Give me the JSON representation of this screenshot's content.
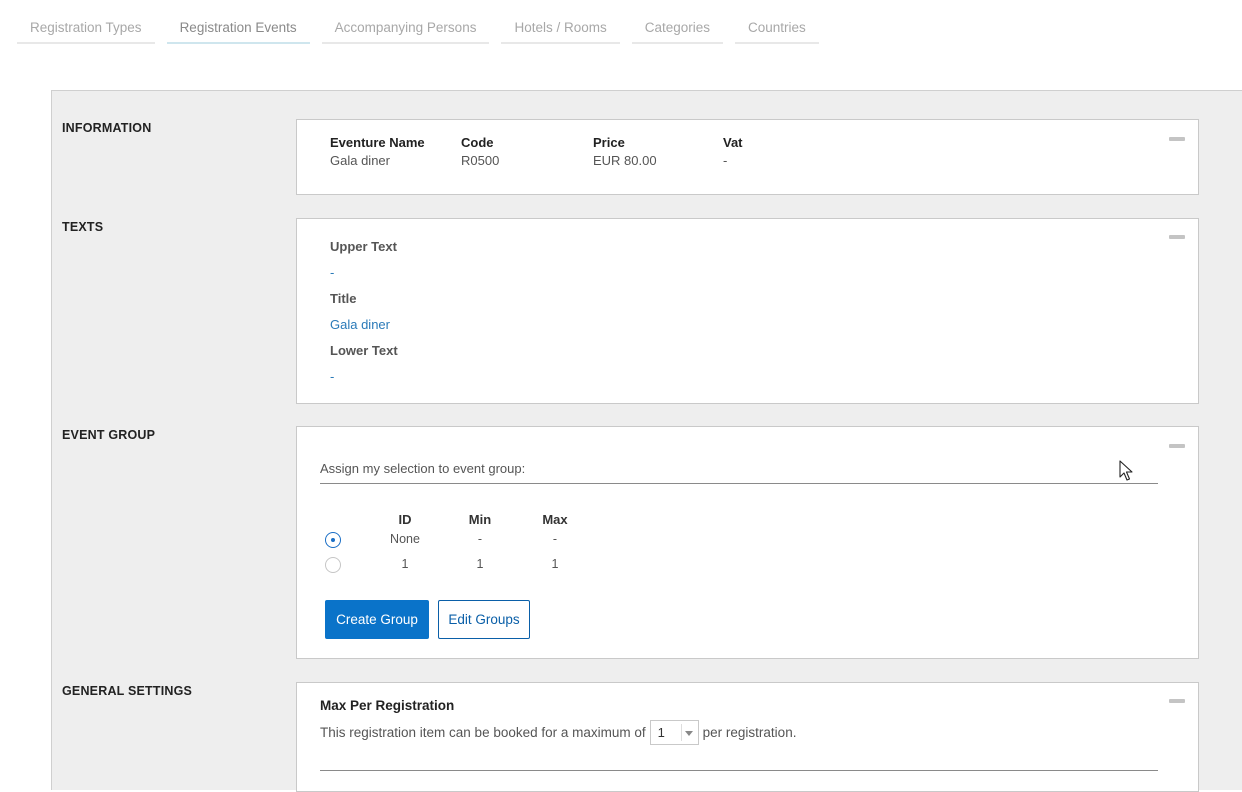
{
  "tabs": [
    {
      "label": "Registration Types"
    },
    {
      "label": "Registration Events"
    },
    {
      "label": "Accompanying Persons"
    },
    {
      "label": "Hotels / Rooms"
    },
    {
      "label": "Categories"
    },
    {
      "label": "Countries"
    }
  ],
  "active_tab": "Registration Events",
  "sections": {
    "information": {
      "label": "INFORMATION",
      "columns": [
        {
          "header": "Eventure Name",
          "value": "Gala diner"
        },
        {
          "header": "Code",
          "value": "R0500"
        },
        {
          "header": "Price",
          "value": "EUR 80.00"
        },
        {
          "header": "Vat",
          "value": "-"
        }
      ]
    },
    "texts": {
      "label": "TEXTS",
      "upper_text_label": "Upper Text",
      "upper_text_value": "-",
      "title_label": "Title",
      "title_value": "Gala diner",
      "lower_text_label": "Lower Text",
      "lower_text_value": "-"
    },
    "event_group": {
      "label": "EVENT GROUP",
      "assign_text": "Assign my selection to event group:",
      "headers": {
        "id": "ID",
        "min": "Min",
        "max": "Max"
      },
      "rows": [
        {
          "id": "None",
          "min": "-",
          "max": "-",
          "selected": true
        },
        {
          "id": "1",
          "min": "1",
          "max": "1",
          "selected": false
        }
      ],
      "create_button": "Create Group",
      "edit_button": "Edit Groups"
    },
    "general_settings": {
      "label": "GENERAL SETTINGS",
      "max_title": "Max Per Registration",
      "max_prefix": "This registration item can be booked for a maximum of",
      "max_value": "1",
      "max_suffix": "per registration."
    }
  },
  "colors": {
    "accent": "#0a73c9",
    "link": "#2a7ab8",
    "panel_bg": "#eeeeee"
  }
}
